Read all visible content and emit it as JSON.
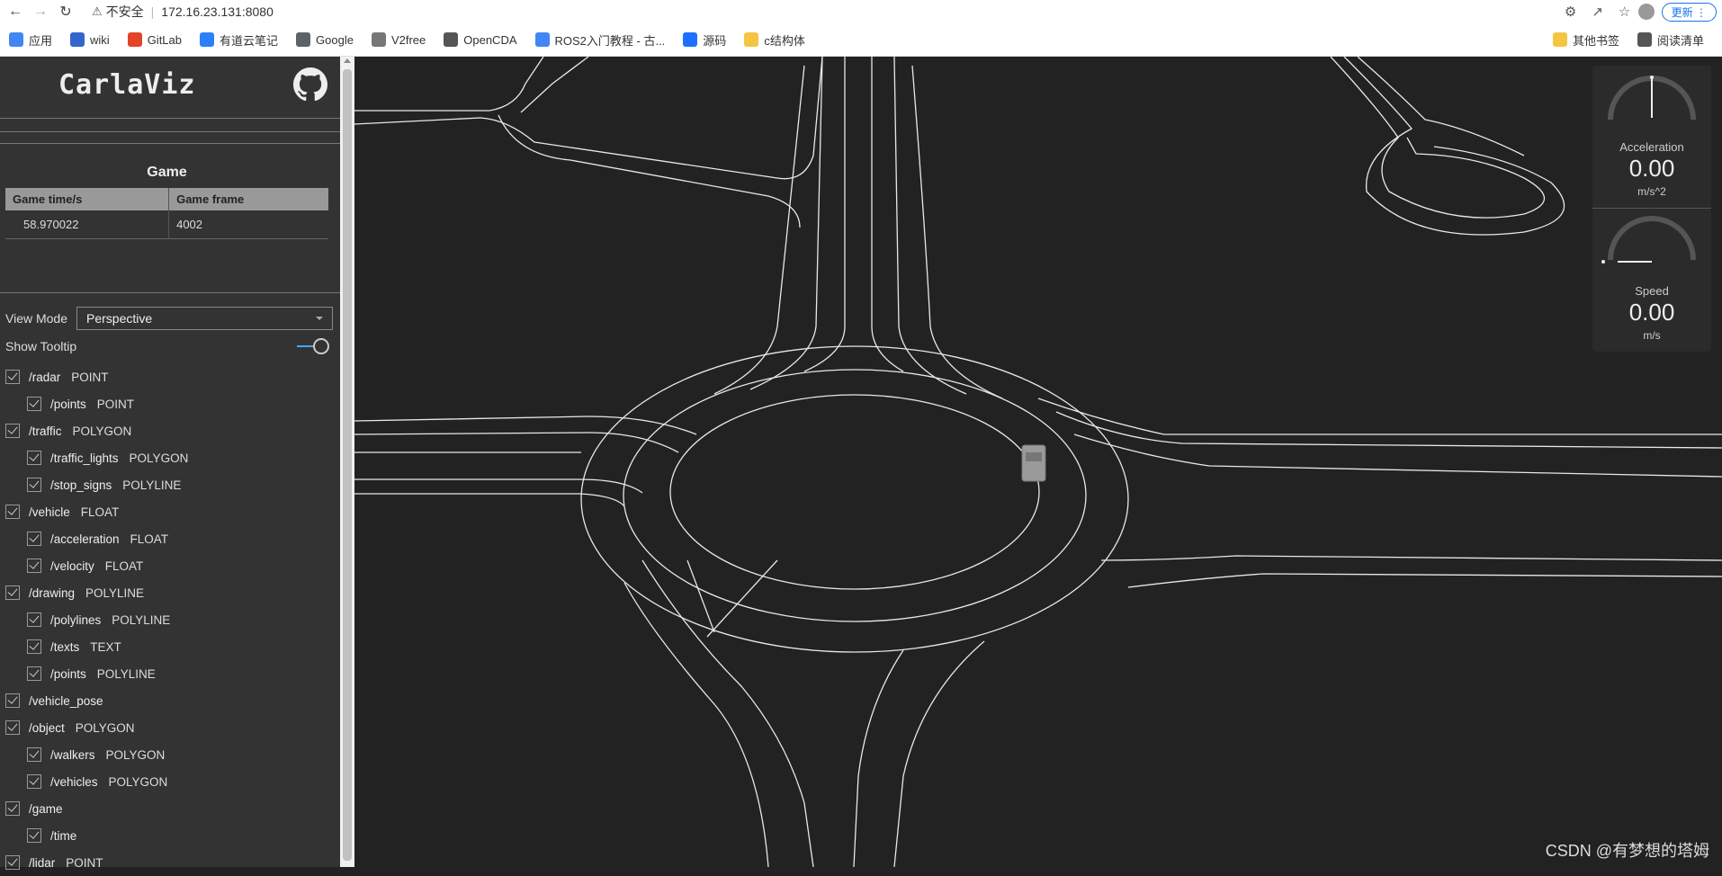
{
  "browser": {
    "security_label": "不安全",
    "url": "172.16.23.131:8080",
    "update_label": "更新",
    "bookmarks": [
      {
        "label": "应用",
        "color": "#4285f4"
      },
      {
        "label": "wiki",
        "color": "#3366cc"
      },
      {
        "label": "GitLab",
        "color": "#e24329"
      },
      {
        "label": "有道云笔记",
        "color": "#2d7ff9"
      },
      {
        "label": "Google",
        "color": "#5f6368"
      },
      {
        "label": "V2free",
        "color": "#777777"
      },
      {
        "label": "OpenCDA",
        "color": "#555555"
      },
      {
        "label": "ROS2入门教程 - 古...",
        "color": "#4285f4"
      },
      {
        "label": "源码",
        "color": "#1e6fff"
      },
      {
        "label": "c结构体",
        "color": "#f5c542"
      }
    ],
    "bookmarks_right": [
      {
        "label": "其他书签",
        "color": "#f5c542"
      },
      {
        "label": "阅读清单",
        "color": "#555555"
      }
    ]
  },
  "sidebar": {
    "title": "CarlaViz",
    "game": {
      "heading": "Game",
      "columns": [
        "Game time/s",
        "Game frame"
      ],
      "row": [
        "58.970022",
        "4002"
      ]
    },
    "view_mode_label": "View Mode",
    "view_mode_value": "Perspective",
    "show_tooltip_label": "Show Tooltip",
    "show_tooltip_on": true,
    "streams": [
      {
        "name": "/radar",
        "type": "POINT",
        "child": false
      },
      {
        "name": "/points",
        "type": "POINT",
        "child": true
      },
      {
        "name": "/traffic",
        "type": "POLYGON",
        "child": false
      },
      {
        "name": "/traffic_lights",
        "type": "POLYGON",
        "child": true
      },
      {
        "name": "/stop_signs",
        "type": "POLYLINE",
        "child": true
      },
      {
        "name": "/vehicle",
        "type": "FLOAT",
        "child": false
      },
      {
        "name": "/acceleration",
        "type": "FLOAT",
        "child": true
      },
      {
        "name": "/velocity",
        "type": "FLOAT",
        "child": true
      },
      {
        "name": "/drawing",
        "type": "POLYLINE",
        "child": false
      },
      {
        "name": "/polylines",
        "type": "POLYLINE",
        "child": true
      },
      {
        "name": "/texts",
        "type": "TEXT",
        "child": true
      },
      {
        "name": "/points",
        "type": "POLYLINE",
        "child": true
      },
      {
        "name": "/vehicle_pose",
        "type": "",
        "child": false
      },
      {
        "name": "/object",
        "type": "POLYGON",
        "child": false
      },
      {
        "name": "/walkers",
        "type": "POLYGON",
        "child": true
      },
      {
        "name": "/vehicles",
        "type": "POLYGON",
        "child": true
      },
      {
        "name": "/game",
        "type": "",
        "child": false
      },
      {
        "name": "/time",
        "type": "",
        "child": true
      },
      {
        "name": "/lidar",
        "type": "POINT",
        "child": false
      }
    ]
  },
  "gauges": {
    "acceleration": {
      "label": "Acceleration",
      "value": "0.00",
      "unit": "m/s^2"
    },
    "speed": {
      "label": "Speed",
      "value": "0.00",
      "unit": "m/s"
    }
  },
  "watermark": "CSDN @有梦想的塔姆"
}
